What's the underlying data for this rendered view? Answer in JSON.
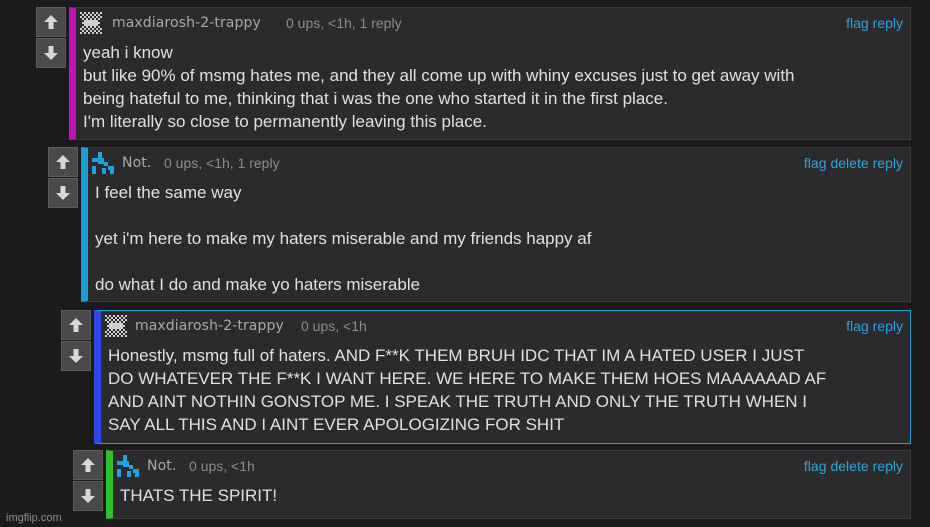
{
  "comments": [
    {
      "username": "maxdiarosh-2-trappy",
      "meta": "0 ups, <1h, 1 reply",
      "actions": [
        "flag",
        "reply"
      ],
      "accent": "#c211b6",
      "avatar": "grey-pixel-avatar",
      "lines": [
        "yeah i know",
        "but like 90% of msmg hates me, and they all come up with whiny excuses just to get away with",
        "being hateful to me, thinking that i was the one who started it in the first place.",
        "I'm literally so close to permanently leaving this place."
      ]
    },
    {
      "username": "Not.",
      "meta": "0 ups, <1h, 1 reply",
      "actions": [
        "flag",
        "delete",
        "reply"
      ],
      "accent": "#1e9fd4",
      "avatar": "blue-pixel-avatar",
      "lines": [
        "I feel the same way",
        "",
        "yet i'm here to make my haters miserable and my friends happy af",
        "",
        "do what I do and make yo haters miserable"
      ]
    },
    {
      "username": "maxdiarosh-2-trappy",
      "meta": "0 ups, <1h",
      "actions": [
        "flag",
        "reply"
      ],
      "accent": "#2f47e6",
      "avatar": "grey-pixel-avatar",
      "lines": [
        "Honestly, msmg full of haters. AND F**K THEM BRUH IDC THAT IM A HATED USER I JUST",
        "DO WHATEVER THE F**K I WANT HERE. WE HERE TO MAKE THEM HOES MAAAAAAD AF",
        "AND AINT NOTHIN GONSTOP ME. I SPEAK THE TRUTH AND ONLY THE TRUTH WHEN I",
        "SAY ALL THIS AND I AINT EVER APOLOGIZING FOR SHIT"
      ]
    },
    {
      "username": "Not.",
      "meta": "0 ups, <1h",
      "actions": [
        "flag",
        "delete",
        "reply"
      ],
      "accent": "#2fc22f",
      "avatar": "blue-pixel-avatar",
      "lines": [
        "THATS THE SPIRIT!"
      ]
    }
  ],
  "watermark": "imgflip.com"
}
